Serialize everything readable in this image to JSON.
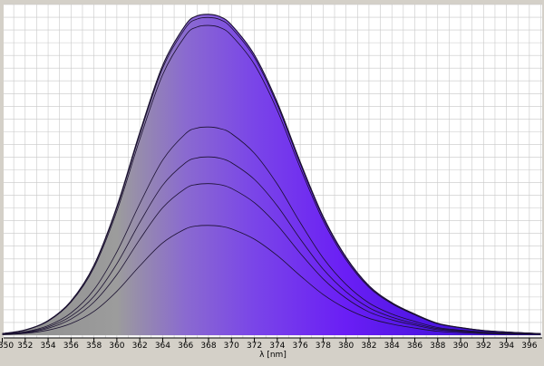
{
  "chart_data": {
    "type": "area",
    "xlabel": "λ [nm]",
    "ylabel": "",
    "title": "",
    "xlim": [
      350,
      397
    ],
    "ylim": [
      0,
      1
    ],
    "x_ticks": [
      350,
      352,
      354,
      356,
      358,
      360,
      362,
      364,
      366,
      368,
      370,
      372,
      374,
      376,
      378,
      380,
      382,
      384,
      386,
      388,
      390,
      392,
      394,
      396
    ],
    "x_tick_labels": [
      "350",
      "352",
      "354",
      "356",
      "358",
      "360",
      "362",
      "364",
      "366",
      "368",
      "370",
      "372",
      "374",
      "376",
      "378",
      "380",
      "382",
      "384",
      "386",
      "388",
      "390",
      "392",
      "394",
      "396"
    ],
    "grid": true,
    "fill": "gradient",
    "gradient_colors": [
      {
        "x": 350,
        "color": "#8e8e8e"
      },
      {
        "x": 360,
        "color": "#9c9c9c"
      },
      {
        "x": 366,
        "color": "#8a6ad0"
      },
      {
        "x": 372,
        "color": "#7a45e8"
      },
      {
        "x": 380,
        "color": "#6a1ef5"
      },
      {
        "x": 388,
        "color": "#4a14e0"
      },
      {
        "x": 397,
        "color": "#2a0ab0"
      }
    ],
    "x": [
      350,
      352,
      354,
      356,
      358,
      360,
      362,
      364,
      366,
      367,
      368,
      369,
      370,
      372,
      374,
      376,
      378,
      380,
      382,
      384,
      386,
      388,
      390,
      392,
      394,
      396,
      397
    ],
    "series": [
      {
        "values": [
          0.002,
          0.007,
          0.019,
          0.044,
          0.09,
          0.166,
          0.262,
          0.349,
          0.402,
          0.413,
          0.415,
          0.412,
          0.402,
          0.363,
          0.301,
          0.225,
          0.154,
          0.101,
          0.064,
          0.042,
          0.027,
          0.015,
          0.01,
          0.006,
          0.004,
          0.003,
          0.002
        ]
      },
      {
        "values": [
          0.003,
          0.009,
          0.026,
          0.061,
          0.125,
          0.229,
          0.362,
          0.482,
          0.555,
          0.57,
          0.573,
          0.569,
          0.555,
          0.501,
          0.416,
          0.31,
          0.213,
          0.14,
          0.088,
          0.058,
          0.038,
          0.021,
          0.014,
          0.009,
          0.006,
          0.004,
          0.003
        ]
      },
      {
        "values": [
          0.004,
          0.011,
          0.031,
          0.072,
          0.147,
          0.27,
          0.426,
          0.567,
          0.652,
          0.67,
          0.674,
          0.669,
          0.652,
          0.589,
          0.489,
          0.364,
          0.25,
          0.164,
          0.104,
          0.068,
          0.044,
          0.025,
          0.016,
          0.01,
          0.007,
          0.005,
          0.003
        ]
      },
      {
        "values": [
          0.004,
          0.013,
          0.036,
          0.084,
          0.172,
          0.315,
          0.497,
          0.662,
          0.762,
          0.783,
          0.787,
          0.781,
          0.762,
          0.688,
          0.571,
          0.426,
          0.292,
          0.192,
          0.122,
          0.08,
          0.052,
          0.029,
          0.019,
          0.012,
          0.008,
          0.005,
          0.004
        ]
      },
      {
        "values": [
          0.006,
          0.019,
          0.053,
          0.125,
          0.255,
          0.469,
          0.74,
          0.985,
          1.133,
          1.165,
          1.171,
          1.163,
          1.133,
          1.024,
          0.85,
          0.633,
          0.434,
          0.285,
          0.181,
          0.119,
          0.077,
          0.043,
          0.028,
          0.017,
          0.012,
          0.008,
          0.006
        ]
      },
      {
        "values": [
          0.006,
          0.019,
          0.055,
          0.128,
          0.262,
          0.481,
          0.759,
          1.01,
          1.162,
          1.195,
          1.201,
          1.193,
          1.162,
          1.05,
          0.871,
          0.649,
          0.445,
          0.293,
          0.186,
          0.122,
          0.079,
          0.044,
          0.029,
          0.018,
          0.012,
          0.008,
          0.006
        ]
      },
      {
        "values": [
          0.006,
          0.02,
          0.055,
          0.129,
          0.264,
          0.486,
          0.766,
          1.02,
          1.173,
          1.207,
          1.213,
          1.204,
          1.173,
          1.06,
          0.88,
          0.655,
          0.449,
          0.295,
          0.187,
          0.123,
          0.08,
          0.045,
          0.029,
          0.018,
          0.012,
          0.008,
          0.006
        ]
      }
    ]
  }
}
